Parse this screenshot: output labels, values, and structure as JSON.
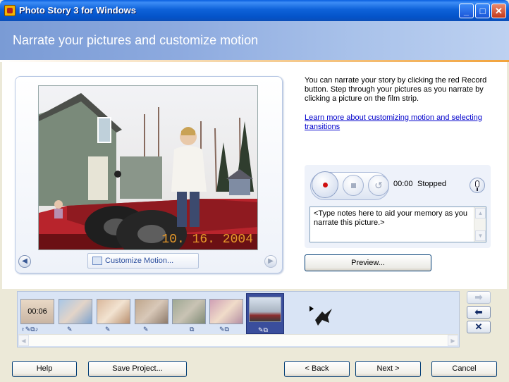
{
  "window": {
    "title": "Photo Story 3 for Windows",
    "minimize_glyph": "_",
    "maximize_glyph": "□",
    "close_glyph": "✕"
  },
  "header": {
    "title": "Narrate your pictures and customize motion"
  },
  "preview": {
    "date_stamp": "10. 16. 2004",
    "customize_label": "Customize Motion...",
    "prev_glyph": "◀",
    "next_glyph": "▶"
  },
  "instructions": {
    "text": "You can narrate your story by clicking the red Record button. Step through your pictures as you narrate by clicking a picture on the film strip.",
    "link": "Learn more about customizing motion and selecting transitions"
  },
  "recorder": {
    "time": "00:00",
    "status": "Stopped",
    "undo_glyph": "↺",
    "notes_placeholder": "<Type notes here to aid your memory as you narrate this picture.>",
    "preview_label": "Preview..."
  },
  "filmstrip": {
    "first_duration": "00:06",
    "thumb_icons": [
      "♀✎⧉♪",
      "✎",
      "✎",
      "✎",
      "⧉",
      "✎⧉",
      "✎⧉"
    ],
    "selected_index": 6,
    "scroll_left": "◀",
    "scroll_right": "▶"
  },
  "side_buttons": {
    "move_right": "➡",
    "move_left": "⬅",
    "remove": "✕"
  },
  "footer": {
    "help": "Help",
    "save": "Save Project...",
    "back": "< Back",
    "next": "Next >",
    "cancel": "Cancel"
  },
  "colors": {
    "title_bar": "#0A5FE0",
    "header": "#8DAADF",
    "record_dot": "#D01010",
    "date_stamp": "#E89A2A"
  }
}
